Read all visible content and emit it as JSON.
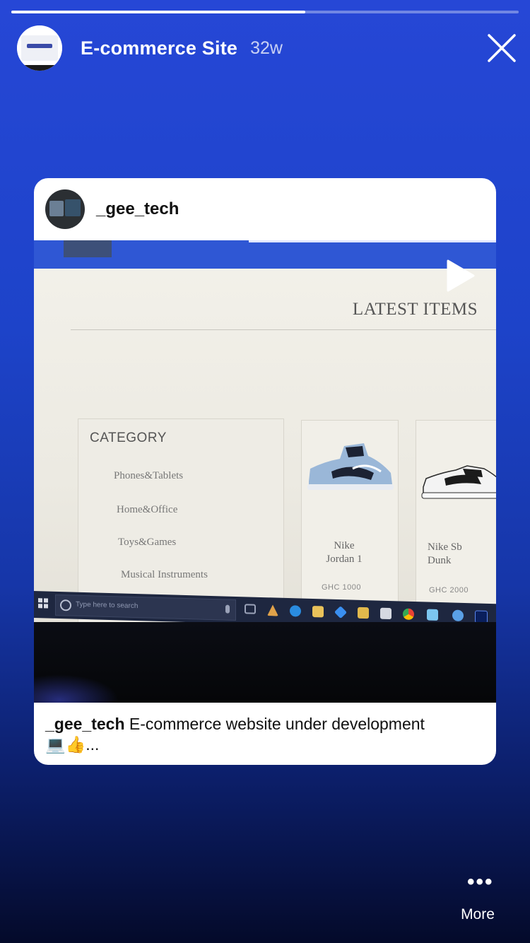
{
  "story": {
    "progress_fraction": 0.58,
    "account_name": "E-commerce Site",
    "age": "32w",
    "close_icon": "close-icon"
  },
  "post": {
    "username": "_gee_tech",
    "caption_user": "_gee_tech",
    "caption_text": " E-commerce website under development",
    "caption_emoji": "💻👍",
    "caption_ellipsis": "...",
    "media": {
      "play_icon": "play-icon",
      "site_heading": "LATEST ITEMS",
      "category_title": "CATEGORY",
      "categories": [
        "Phones&Tablets",
        "Home&Office",
        "Toys&Games",
        "Musical Instruments"
      ],
      "products": [
        {
          "name_line1": "Nike",
          "name_line2": "Jordan 1",
          "price": "GHC 1000"
        },
        {
          "name_line1": "Nike Sb",
          "name_line2": "Dunk",
          "price": "GHC 2000"
        }
      ],
      "taskbar_search_placeholder": "Type here to search"
    }
  },
  "footer": {
    "more_label": "More",
    "more_icon": "ellipsis-icon"
  }
}
